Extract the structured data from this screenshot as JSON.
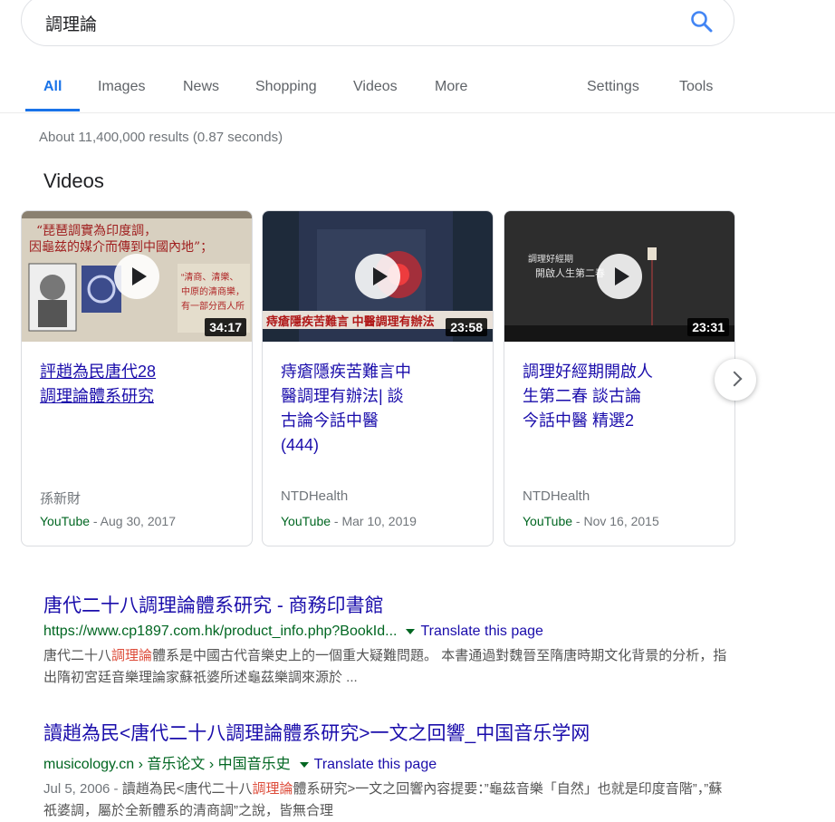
{
  "search": {
    "query": "調理論"
  },
  "tabs": [
    "All",
    "Images",
    "News",
    "Shopping",
    "Videos",
    "More"
  ],
  "tools": {
    "settings": "Settings",
    "tools": "Tools"
  },
  "result_stats": "About 11,400,000 results (0.87 seconds)",
  "videos_heading": "Videos",
  "videos": [
    {
      "title_line1": "評趙為民唐代28",
      "title_line2": "調理論體系研究",
      "duration": "34:17",
      "channel": "孫新財",
      "source": "YouTube",
      "date": " - Aug 30, 2017",
      "thumb_text1": "“琵琶調實為印度調，",
      "thumb_text2": "因龜兹的媒介而傳到中國內地”；"
    },
    {
      "title_line1": "痔瘡隱疾苦難言中",
      "title_line2": "醫調理有辦法| 談",
      "title_line3": "古論今話中醫",
      "title_line4": "(444)",
      "duration": "23:58",
      "channel": "NTDHealth",
      "source": "YouTube",
      "date": " - Mar 10, 2019",
      "thumb_caption": "痔瘡隱疾苦難言 中醫調理有辦法"
    },
    {
      "title_line1": "調理好經期開啟人",
      "title_line2": "生第二春 談古論",
      "title_line3": "今話中醫 精選2",
      "duration": "23:31",
      "channel": "NTDHealth",
      "source": "YouTube",
      "date": " - Nov 16, 2015",
      "thumb_text1": "調理好經期",
      "thumb_text2": "開啟人生第二春"
    }
  ],
  "results": [
    {
      "title": "唐代二十八調理論體系研究 - 商務印書館",
      "url": "https://www.cp1897.com.hk/product_info.php?BookId...",
      "translate": "Translate this page",
      "snippet_pre": "唐代二十八",
      "snippet_em": "調理論",
      "snippet_post": "體系是中國古代音樂史上的一個重大疑難問題。 本書通過對魏晉至隋唐時期文化背景的分析，指出隋初宮廷音樂理論家蘇祇婆所述龜茲樂調來源於 ..."
    },
    {
      "title": "讀趙為民<唐代二十八調理論體系研究>一文之回響_中国音乐学网",
      "url": "musicology.cn › 音乐论文 › 中国音乐史",
      "translate": "Translate this page",
      "date": "Jul 5, 2006 - ",
      "snippet_pre": "讀趙為民<唐代二十八",
      "snippet_em": "調理論",
      "snippet_post": "體系研究>一文之回響內容提要：”龜茲音樂「自然」也就是印度音階”，”蘇祇婆調，屬於全新體系的清商調”之說，皆無合理"
    }
  ],
  "colors": {
    "link": "#1a0dab",
    "url": "#006621",
    "accent": "#1a73e8",
    "highlight": "#dd4b39"
  }
}
